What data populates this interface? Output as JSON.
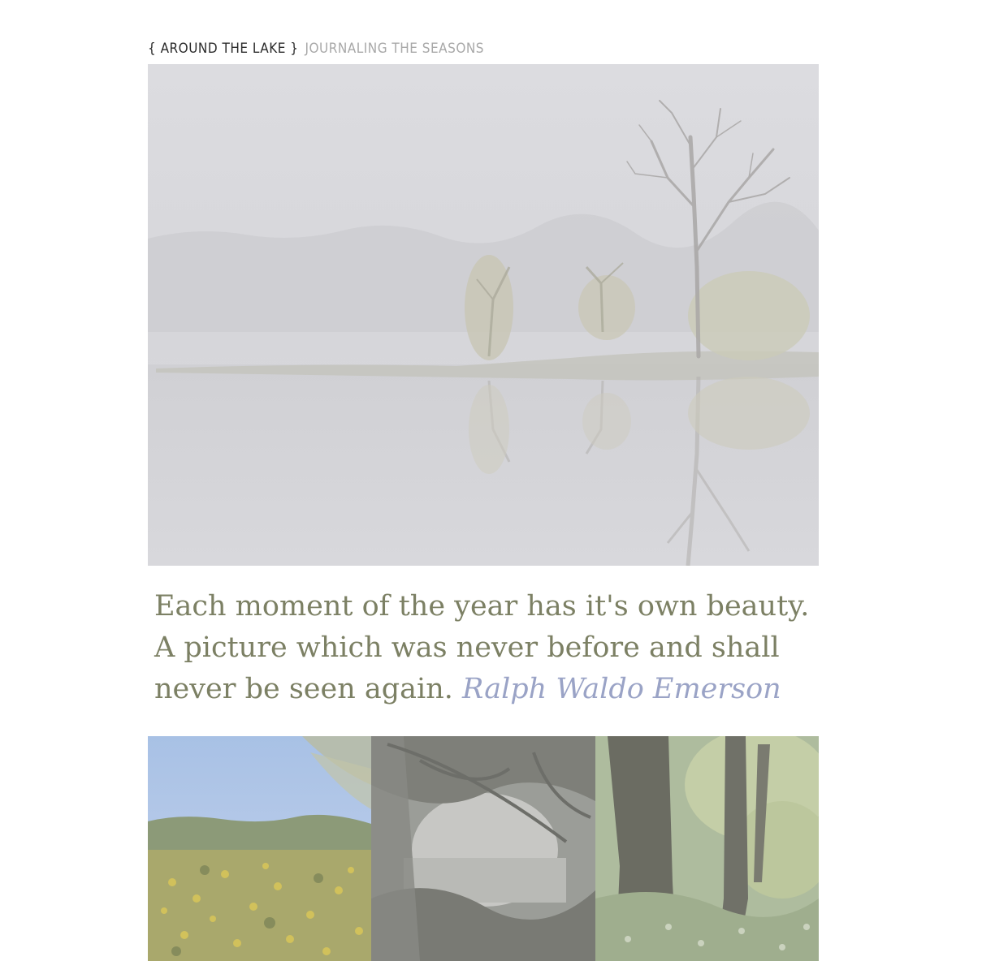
{
  "header": {
    "brand": "{ AROUND THE LAKE }",
    "tagline": "JOURNALING THE SEASONS"
  },
  "hero": {
    "icon": "foggy-lake-photo"
  },
  "quote": {
    "text": "Each moment of the year has it's own beauty. A picture which was never before and shall never be seen again.",
    "author": "Ralph Waldo Emerson"
  },
  "thumbnails": [
    {
      "icon": "wildflowers-photo"
    },
    {
      "icon": "lake-through-trees-photo"
    },
    {
      "icon": "tree-trunks-photo"
    }
  ],
  "colors": {
    "quote_text": "#7c8064",
    "quote_author": "#9aa3c6",
    "brand": "#2a2a2a",
    "tagline": "#a8a8a8"
  }
}
